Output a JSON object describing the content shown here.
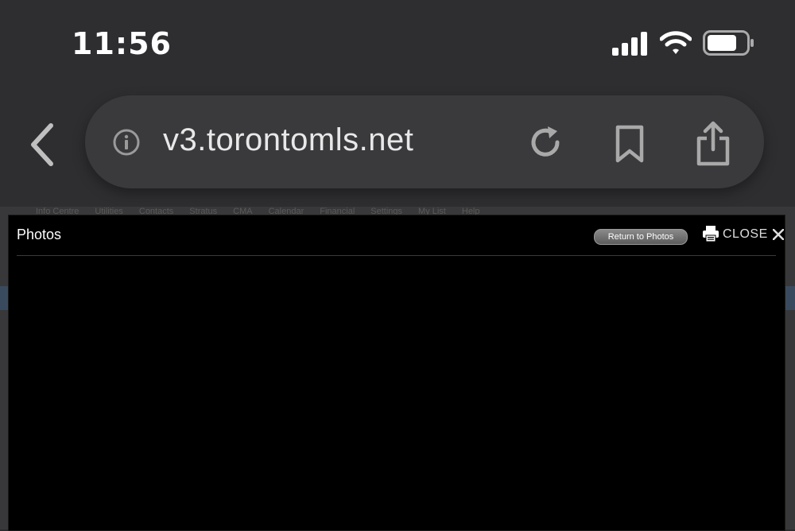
{
  "status_bar": {
    "time": "11:56",
    "icons": [
      "cellular-signal-icon",
      "wifi-icon",
      "battery-icon"
    ]
  },
  "browser": {
    "url": "v3.torontomls.net",
    "icons": [
      "back-chevron-icon",
      "info-icon",
      "reload-icon",
      "bookmark-icon",
      "share-icon"
    ]
  },
  "background_page": {
    "nav_items": [
      "Info Centre",
      "Utilities",
      "Contacts",
      "Stratus",
      "CMA",
      "Calendar",
      "Financial",
      "Settings",
      "My List",
      "Help"
    ]
  },
  "modal": {
    "title": "Photos",
    "return_button": "Return to Photos",
    "close_label": "CLOSE"
  },
  "colors": {
    "chrome_bg": "#2e2e31",
    "pill_bg": "#3a3a3d",
    "modal_bg": "#000000"
  }
}
